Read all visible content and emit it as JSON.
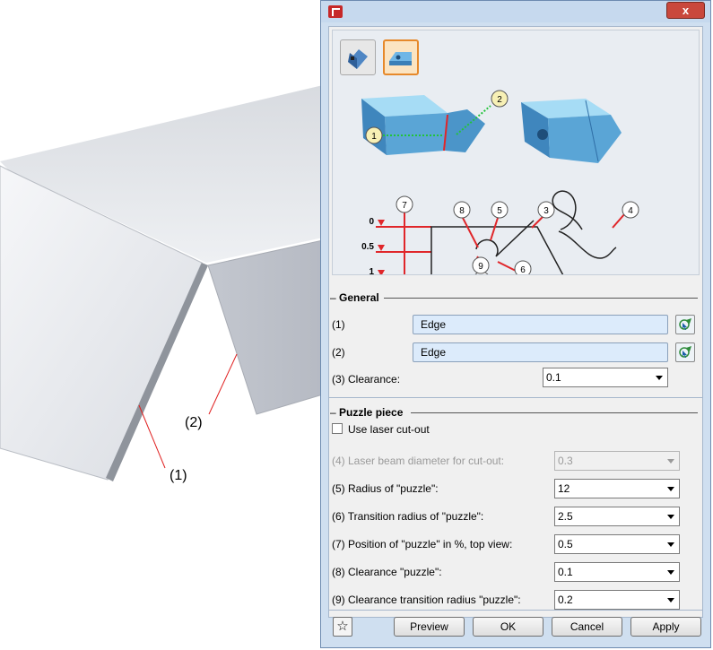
{
  "background": {
    "label_1": "(1)",
    "label_2": "(2)"
  },
  "dialog": {
    "close_glyph": "x",
    "schematic": {
      "top_callouts": [
        "1",
        "2"
      ],
      "numbers": [
        "7",
        "8",
        "5",
        "3",
        "4",
        "6",
        "9"
      ],
      "levels": [
        "0",
        "0.5",
        "1"
      ]
    },
    "general": {
      "title": "General",
      "row1_label": "(1)",
      "row1_value": "Edge",
      "row2_label": "(2)",
      "row2_value": "Edge",
      "clearance_label": "(3) Clearance:",
      "clearance_value": "0.1"
    },
    "puzzle": {
      "title": "Puzzle piece",
      "laser_label": "Use laser cut-out",
      "laser_checked": false,
      "rows": [
        {
          "label": "(4) Laser beam diameter for cut-out:",
          "value": "0.3",
          "disabled": true
        },
        {
          "label": "(5) Radius of \"puzzle\":",
          "value": "12",
          "disabled": false
        },
        {
          "label": "(6) Transition radius of \"puzzle\":",
          "value": "2.5",
          "disabled": false
        },
        {
          "label": "(7) Position of \"puzzle\" in %, top view:",
          "value": "0.5",
          "disabled": false
        },
        {
          "label": "(8) Clearance \"puzzle\":",
          "value": "0.1",
          "disabled": false
        },
        {
          "label": "(9) Clearance transition radius \"puzzle\":",
          "value": "0.2",
          "disabled": false
        }
      ]
    },
    "buttons": {
      "favorite_glyph": "☆",
      "preview": "Preview",
      "ok": "OK",
      "cancel": "Cancel",
      "apply": "Apply"
    },
    "colors": {
      "accent_red": "#e0262a",
      "highlight_orange": "#e6892b",
      "sheet_blue": "#7fc4e8"
    }
  }
}
